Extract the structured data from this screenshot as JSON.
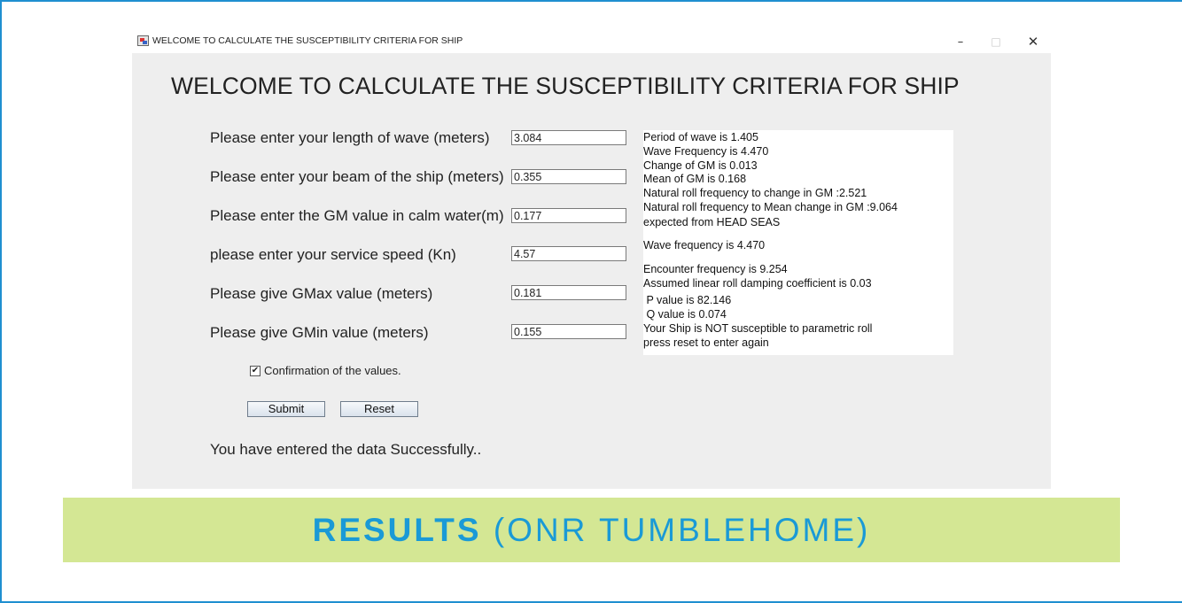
{
  "window": {
    "title": "WELCOME TO CALCULATE THE SUSCEPTIBILITY CRITERIA FOR SHIP",
    "controls": {
      "minimize": "–",
      "maximize": "□",
      "close": "✕"
    }
  },
  "heading": "WELCOME TO CALCULATE THE SUSCEPTIBILITY CRITERIA FOR SHIP",
  "form": {
    "fields": [
      {
        "label": "Please enter your length of wave (meters)",
        "value": "3.084"
      },
      {
        "label": "Please enter your beam of the ship (meters)",
        "value": "0.355"
      },
      {
        "label": "Please enter the GM value in calm water(m)",
        "value": "0.177"
      },
      {
        "label": "please enter your service speed (Kn)",
        "value": "4.57"
      },
      {
        "label": "Please give GMax value (meters)",
        "value": "0.181"
      },
      {
        "label": "Please give GMin value (meters)",
        "value": "0.155"
      }
    ],
    "confirmation": {
      "label": "Confirmation of the values.",
      "checked": true,
      "mark": "✔"
    },
    "submit_label": "Submit",
    "reset_label": "Reset"
  },
  "results": {
    "lines": [
      "Period of wave is 1.405",
      "Wave Frequency is 4.470",
      "Change of GM is 0.013",
      "Mean of GM is 0.168",
      "Natural roll frequency to change in GM :2.521",
      "Natural roll frequency to Mean change in GM :9.064",
      "expected from HEAD SEAS",
      "Wave frequency is 4.470",
      "Encounter frequency is 9.254",
      "Assumed linear roll damping coefficient is 0.03",
      " P value is 82.146",
      " Q value is 0.074",
      "Your Ship is NOT susceptible to parametric roll",
      "press reset to enter again"
    ]
  },
  "status_message": "You have entered the data Successfully..",
  "caption": {
    "strong": "RESULTS",
    "rest": " (ONR TUMBLEHOME)"
  },
  "colors": {
    "accent_line": "#1f8fd0",
    "caption_background": "#d4e794",
    "caption_text": "#1a9ad6",
    "window_body": "#eeeeee"
  }
}
